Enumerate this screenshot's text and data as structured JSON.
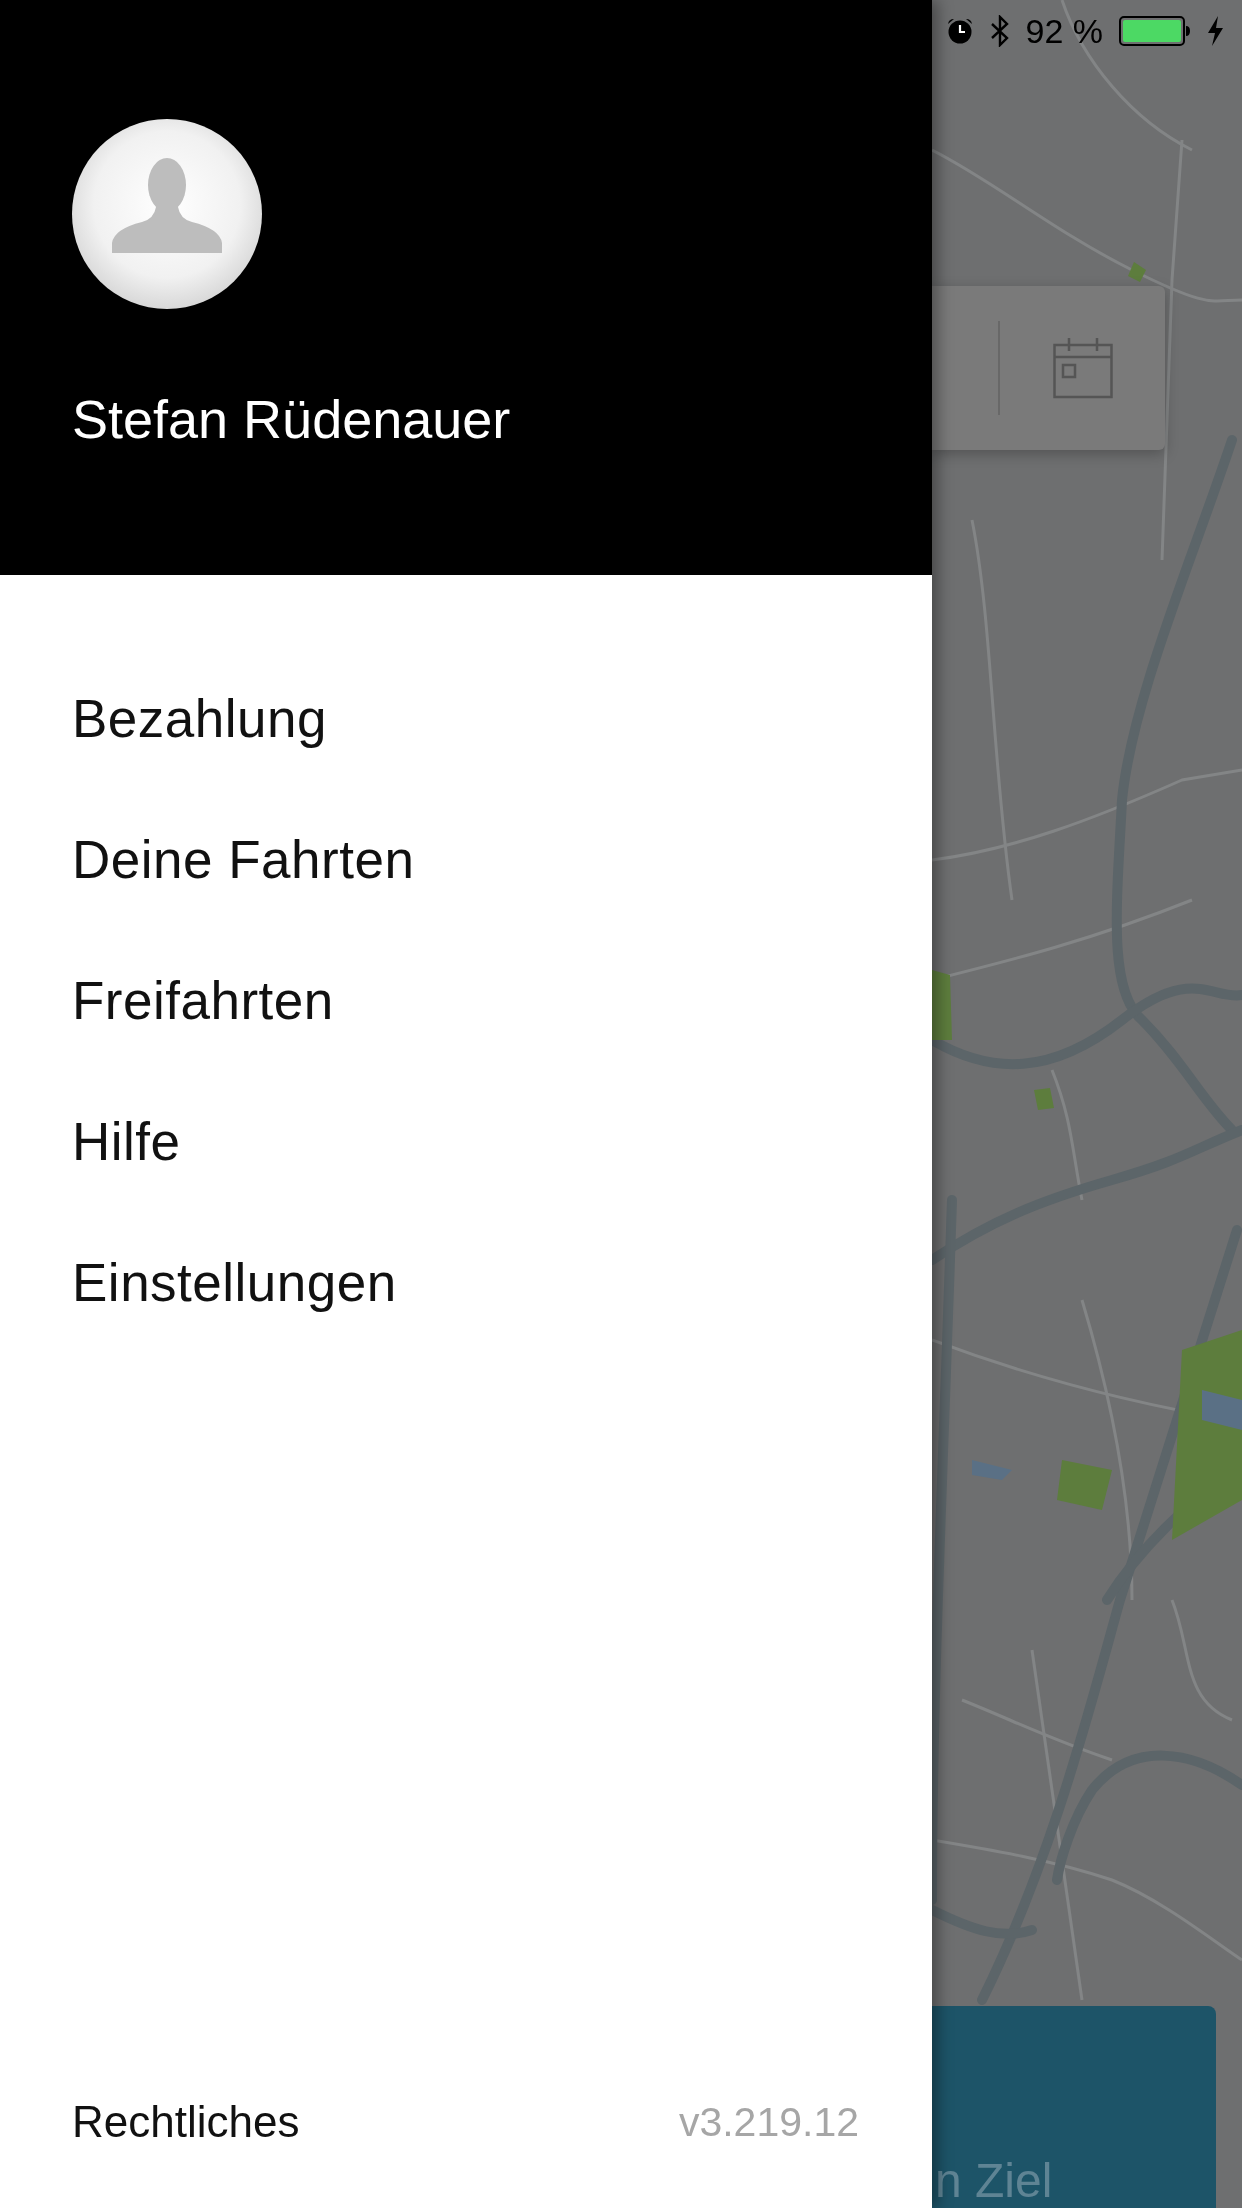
{
  "status_bar": {
    "battery_percent": "92 %"
  },
  "drawer": {
    "user_name": "Stefan Rüdenauer",
    "menu_items": [
      "Bezahlung",
      "Deine Fahrten",
      "Freifahrten",
      "Hilfe",
      "Einstellungen"
    ],
    "footer": {
      "legal_link": "Rechtliches",
      "version": "v3.219.12"
    }
  },
  "background": {
    "destination_button": {
      "label": "n Ziel"
    }
  }
}
